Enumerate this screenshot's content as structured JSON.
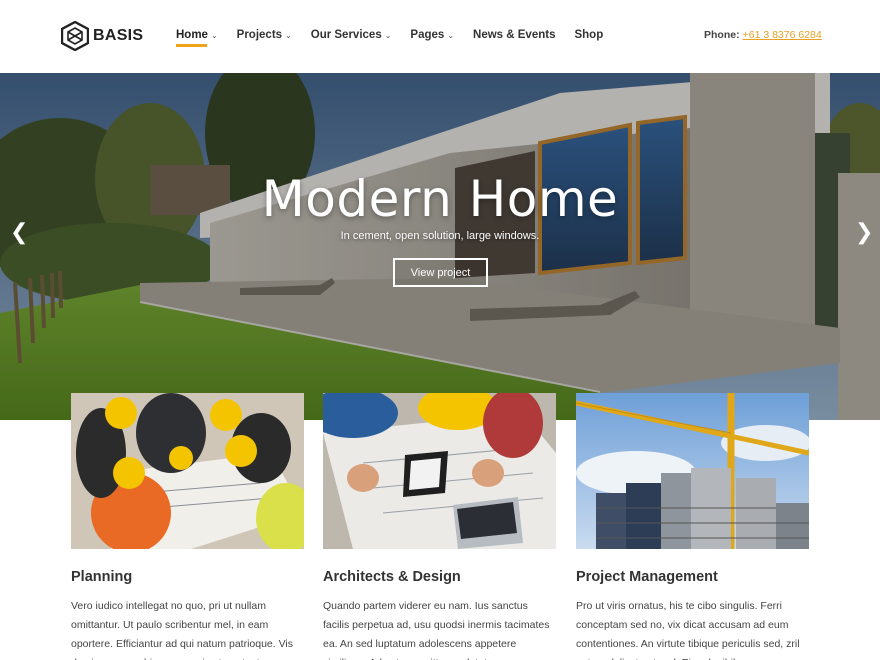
{
  "brand": {
    "name": "BASIS"
  },
  "nav": {
    "items": [
      {
        "label": "Home",
        "dropdown": true
      },
      {
        "label": "Projects",
        "dropdown": true
      },
      {
        "label": "Our Services",
        "dropdown": true
      },
      {
        "label": "Pages",
        "dropdown": true
      },
      {
        "label": "News & Events",
        "dropdown": false
      },
      {
        "label": "Shop",
        "dropdown": false
      }
    ],
    "active": "Home"
  },
  "phone": {
    "label": "Phone:",
    "number": "+61 3 8376 6284"
  },
  "hero": {
    "title": "Modern Home",
    "subtitle": "In cement, open solution, large windows.",
    "button": "View project",
    "prev_icon": "chevron-left-icon",
    "next_icon": "chevron-right-icon"
  },
  "features": [
    {
      "title": "Planning",
      "text": "Vero iudico intellegat no quo, pri ut nullam omittantur. Ut paulo scribentur mel, in eam oportere. Efficiantur ad qui natum patrioque. Vis doming menandri persequeris ut, ne tantas"
    },
    {
      "title": "Architects & Design",
      "text": "Quando partem viderer eu nam. Ius sanctus facilis perpetua ad, usu quodsi inermis tacimates ea. An sed luptatum adolescens appetere similique. Ad est ex omittam salutatus, an"
    },
    {
      "title": "Project Management",
      "text": "Pro ut viris ornatus, his te cibo singulis. Ferri conceptam sed no, vix dicat accusam ad eum contentiones. An virtute tibique periculis sed, zril natum delicata ut mel. Ei mel, nihil"
    }
  ],
  "colors": {
    "accent": "#f0a21b",
    "phone": "#e8a020"
  }
}
